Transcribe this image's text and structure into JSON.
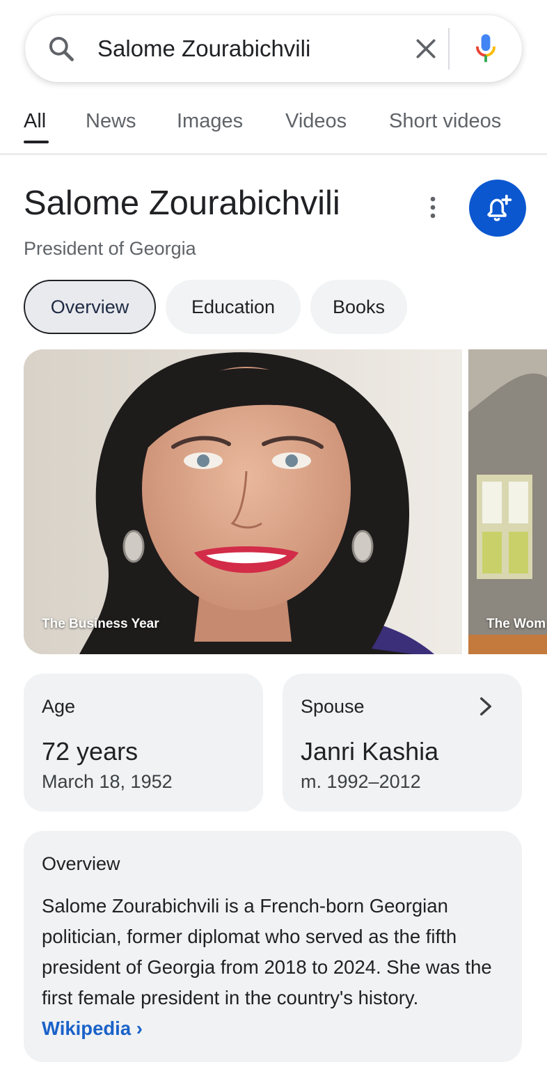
{
  "search": {
    "query": "Salome Zourabichvili",
    "icons": {
      "search": "search-icon",
      "clear": "close-icon",
      "voice": "mic-icon"
    }
  },
  "tabs": [
    {
      "label": "All",
      "active": true
    },
    {
      "label": "News"
    },
    {
      "label": "Images"
    },
    {
      "label": "Videos"
    },
    {
      "label": "Short videos"
    }
  ],
  "entity": {
    "title": "Salome Zourabichvili",
    "subtitle": "President of Georgia",
    "icons": {
      "more": "more-vert-icon",
      "follow": "bell-plus-icon"
    },
    "accent_color": "#0b57d0"
  },
  "chips": [
    {
      "label": "Overview",
      "active": true
    },
    {
      "label": "Education"
    },
    {
      "label": "Books"
    }
  ],
  "images": [
    {
      "credit": "The Business Year"
    },
    {
      "credit": "The Wom"
    }
  ],
  "facts": {
    "age": {
      "label": "Age",
      "value": "72 years",
      "detail": "March 18, 1952"
    },
    "spouse": {
      "label": "Spouse",
      "value": "Janri Kashia",
      "detail": "m. 1992–2012"
    }
  },
  "overview": {
    "heading": "Overview",
    "text": "Salome Zourabichvili is a French-born Georgian politician, former diplomat who served as the fifth president of Georgia from 2018 to 2024. She was the first female president in the country's history.",
    "link_label": "Wikipedia ›",
    "link_color": "#1a62c9"
  }
}
